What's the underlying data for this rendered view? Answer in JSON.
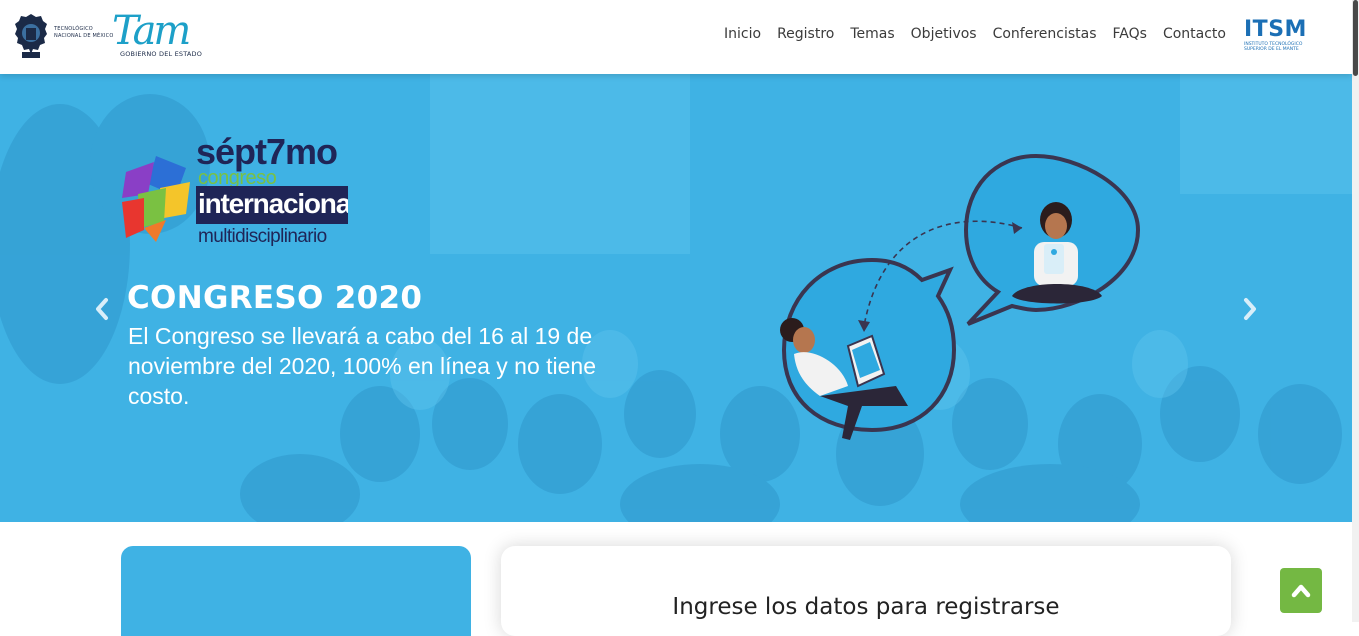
{
  "header": {
    "tecnm_logo_text": [
      "TECNOLÓGICO",
      "NACIONAL DE MÉXICO"
    ],
    "tam_logo_word": "Tam",
    "tam_logo_sub": "GOBIERNO DEL ESTADO",
    "itsm_logo_word": "ITSM",
    "itsm_logo_sub": [
      "INSTITUTO TECNOLÓGICO",
      "SUPERIOR DE EL MANTE"
    ],
    "nav": [
      {
        "label": "Inicio"
      },
      {
        "label": "Registro"
      },
      {
        "label": "Temas"
      },
      {
        "label": "Objetivos"
      },
      {
        "label": "Conferencistas"
      },
      {
        "label": "FAQs"
      },
      {
        "label": "Contacto"
      }
    ]
  },
  "hero": {
    "logo": {
      "line1": "sépt7mo",
      "line2": "congreso",
      "line3": "internacional",
      "line4": "multidisciplinario"
    },
    "title": "CONGRESO 2020",
    "description": "El Congreso se llevará a cabo del 16 al 19 de noviembre del 2020, 100% en línea y no tiene costo.",
    "prev_icon": "chevron-left-icon",
    "next_icon": "chevron-right-icon"
  },
  "registration": {
    "title": "Ingrese los datos para registrarse"
  },
  "back_to_top_icon": "chevron-up-icon",
  "colors": {
    "hero_blue": "#3fb2e4",
    "navy": "#1f2557",
    "green": "#74b843",
    "tam_blue": "#1da0c8",
    "itsm_blue": "#1b6fb5"
  }
}
